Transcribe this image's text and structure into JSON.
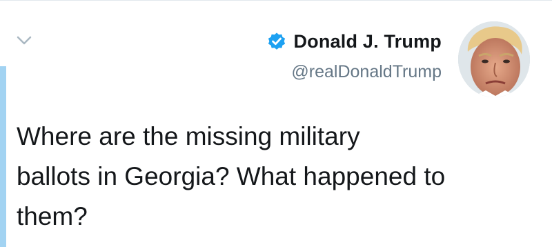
{
  "tweet": {
    "author": {
      "display_name": "Donald J. Trump",
      "handle": "@realDonaldTrump",
      "verified": true
    },
    "text": "Where are the missing military\nballots in Georgia? What happened to\nthem?"
  },
  "icons": {
    "chevron": "chevron-down-icon",
    "verified": "verified-badge-icon",
    "avatar": "profile-avatar"
  },
  "colors": {
    "verified_blue": "#1da1f2",
    "thread_bar": "#a2d3f2",
    "handle_gray": "#657786",
    "text": "#14171a"
  }
}
